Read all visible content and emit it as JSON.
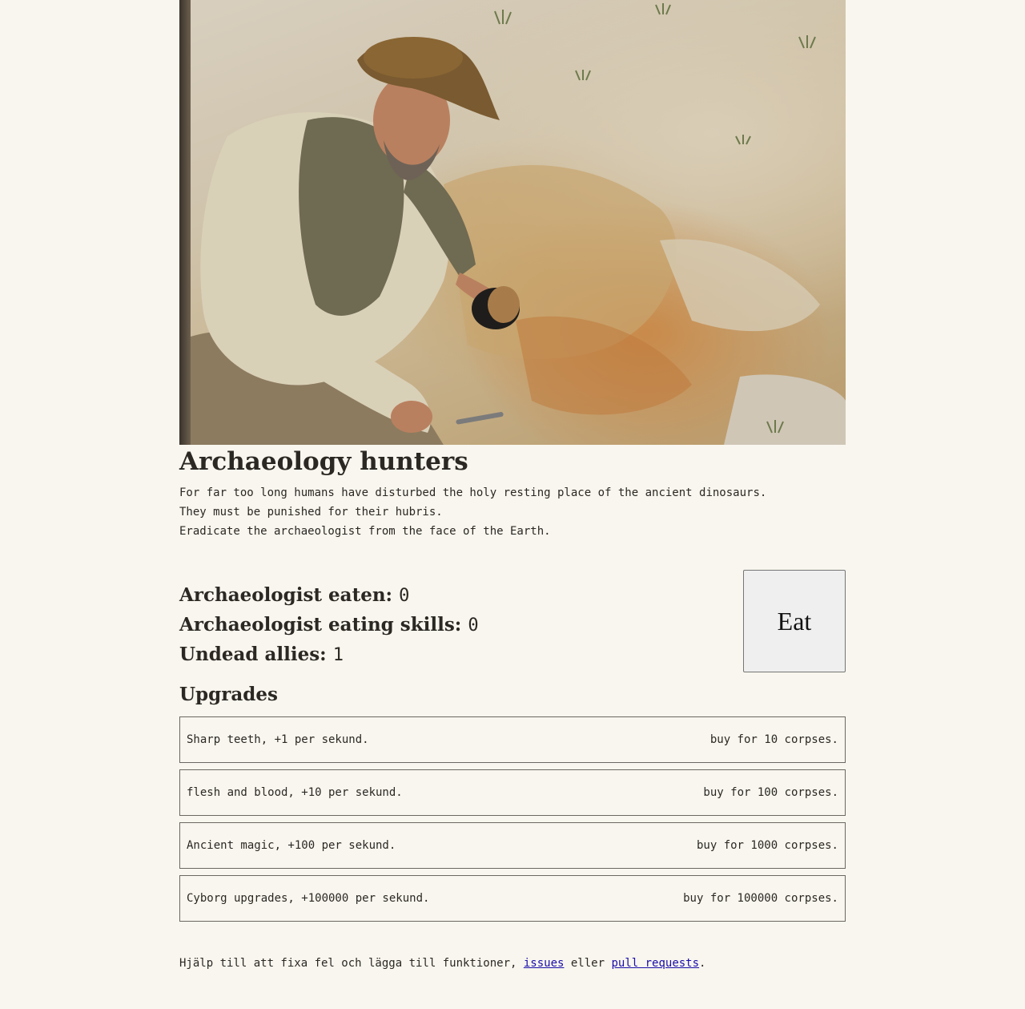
{
  "hero": {
    "image_desc_icon": "archaeologist-photo"
  },
  "title": "Archaeology hunters",
  "intro": [
    "For far too long humans have disturbed the holy resting place of the ancient dinosaurs.",
    "They must be punished for their hubris.",
    "Eradicate the archaeologist from the face of the Earth."
  ],
  "stats": {
    "eaten_label": "Archaeologist eaten:",
    "eaten_value": "0",
    "skills_label": "Archaeologist eating skills:",
    "skills_value": "0",
    "allies_label": "Undead allies:",
    "allies_value": "1"
  },
  "eat_button": "Eat",
  "upgrades_heading": "Upgrades",
  "upgrades": [
    {
      "name": "Sharp teeth, +1 per sekund.",
      "price": "buy for 10 corpses."
    },
    {
      "name": "flesh and blood, +10 per sekund.",
      "price": "buy for 100 corpses."
    },
    {
      "name": "Ancient magic, +100 per sekund.",
      "price": "buy for 1000 corpses."
    },
    {
      "name": "Cyborg upgrades, +100000 per sekund.",
      "price": "buy for 100000 corpses."
    }
  ],
  "footer": {
    "text_before": "Hjälp till att fixa fel och lägga till funktioner, ",
    "link_issues": "issues",
    "text_middle": " eller ",
    "link_prs": "pull requests",
    "text_after": "."
  },
  "colors": {
    "background": "#f8f6ee",
    "text": "#2b2824",
    "link": "#1a0dab"
  }
}
